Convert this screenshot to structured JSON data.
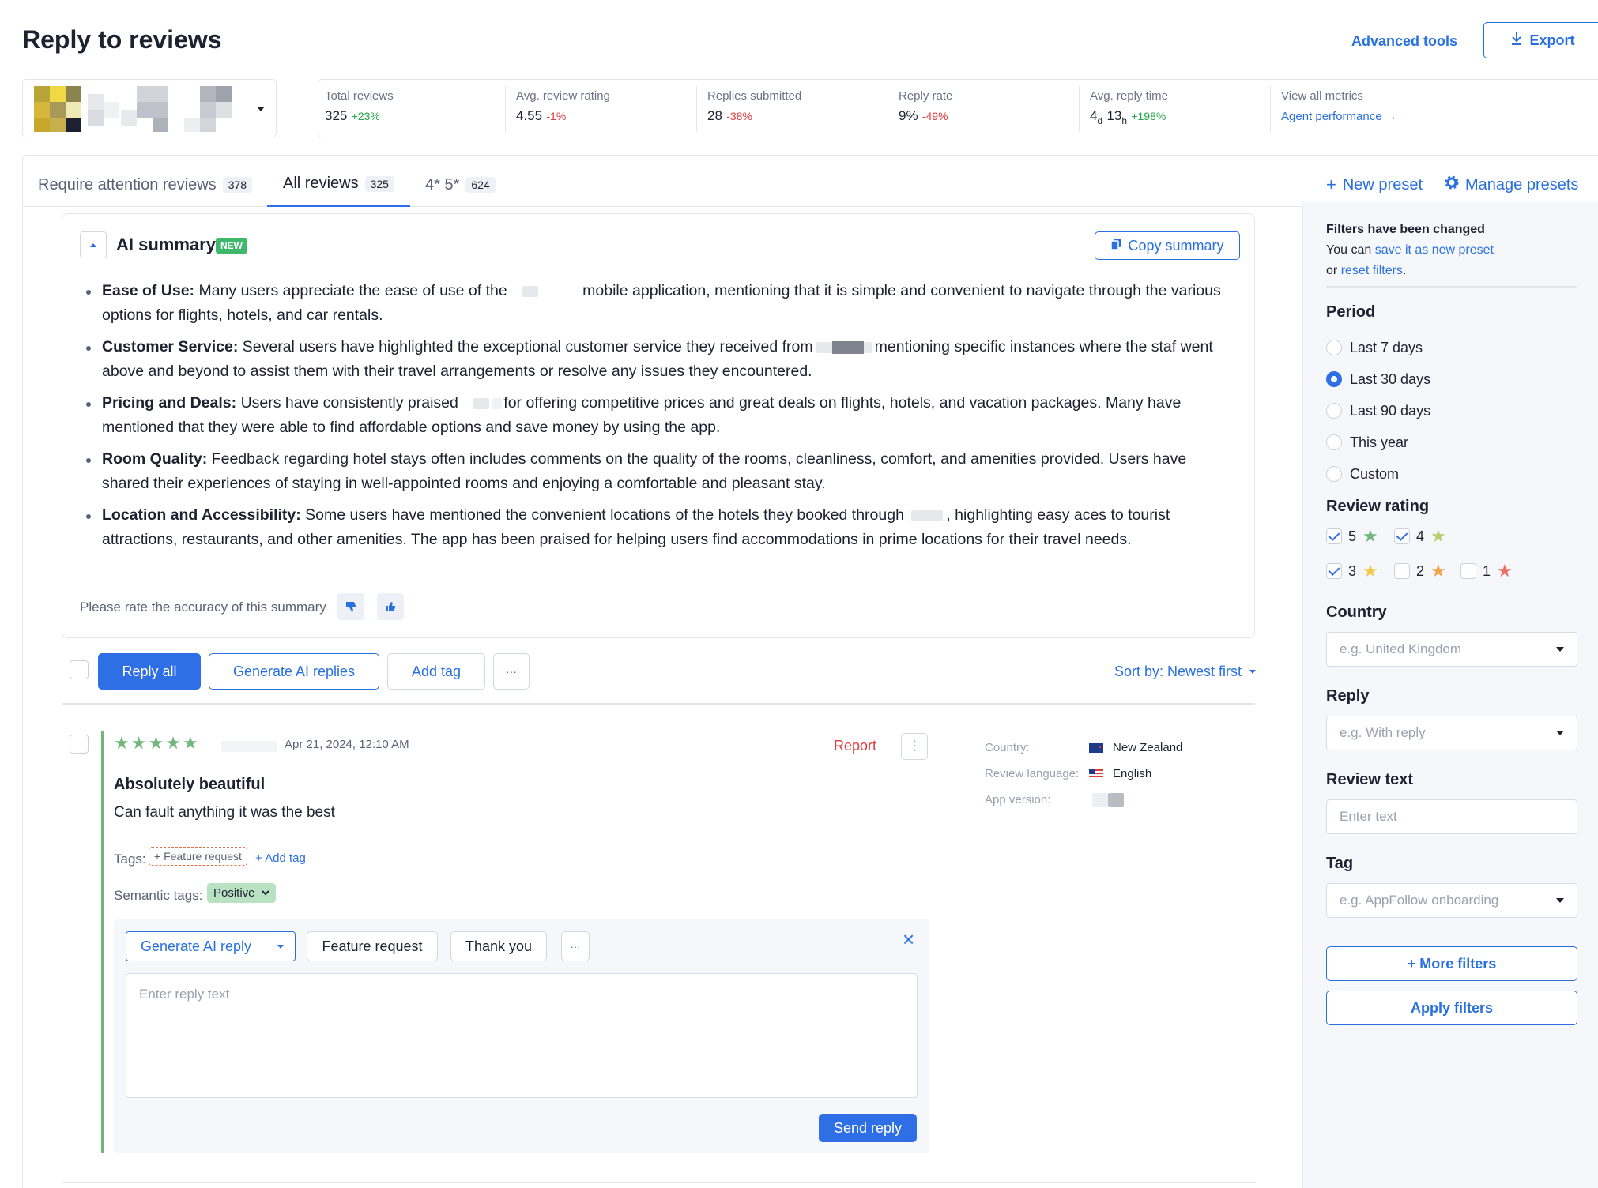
{
  "header": {
    "title": "Reply to reviews",
    "advanced_tools": "Advanced tools",
    "export": "Export"
  },
  "metrics": [
    {
      "label": "Total reviews",
      "value": "325",
      "delta": "+23%",
      "trend": "up"
    },
    {
      "label": "Avg. review rating",
      "value": "4.55",
      "delta": "-1%",
      "trend": "down"
    },
    {
      "label": "Replies submitted",
      "value": "28",
      "delta": "-38%",
      "trend": "down"
    },
    {
      "label": "Reply rate",
      "value": "9%",
      "delta": "-49%",
      "trend": "down"
    },
    {
      "label": "Avg. reply time",
      "value_days": "4",
      "unit_days": "d",
      "value_hours": "13",
      "unit_hours": "h",
      "delta": "+198%",
      "trend": "up"
    }
  ],
  "view_all": {
    "label": "View all metrics",
    "link": "Agent performance →"
  },
  "tabs": [
    {
      "label": "Require attention reviews",
      "count": "378"
    },
    {
      "label": "All reviews",
      "count": "325",
      "active": true
    },
    {
      "label": "4* 5*",
      "count": "624"
    }
  ],
  "presets": {
    "new": "New preset",
    "manage": "Manage presets"
  },
  "ai_summary": {
    "title": "AI summary",
    "badge": "NEW",
    "copy": "Copy summary",
    "items": [
      {
        "head": "Ease of Use:",
        "a": "Many users appreciate the ease of use of the",
        "b": "mobile application, mentioning that it is simple and convenient to navigate through the various options for flights, hotels, and car rentals."
      },
      {
        "head": "Customer Service:",
        "a": "Several users have highlighted the exceptional customer service they received from",
        "b": "mentioning specific instances where the staf went above and beyond to assist them with their travel arrangements or resolve any issues they encountered."
      },
      {
        "head": "Pricing and Deals:",
        "a": "Users have consistently praised",
        "b": "for offering competitive prices and great deals on flights, hotels, and vacation packages. Many have mentioned that they were able to find affordable options and save money by using the app."
      },
      {
        "head": "Room Quality:",
        "a": "Feedback regarding hotel stays often includes comments on the quality of the rooms, cleanliness, comfort, and amenities provided. Users have shared their experiences of staying in well-appointed rooms and enjoying a comfortable and pleasant stay.",
        "b": ""
      },
      {
        "head": "Location and Accessibility:",
        "a": "Some users have mentioned the convenient locations of the hotels they booked through",
        "b": ", highlighting easy aces to tourist attractions, restaurants, and other amenities. The app has been praised for helping users find accommodations in prime locations for their travel needs."
      }
    ],
    "rate_prompt": "Please rate the accuracy of this summary"
  },
  "bulk": {
    "reply_all": "Reply all",
    "generate": "Generate AI replies",
    "add_tag": "Add tag",
    "more": "···",
    "sort": "Sort by: Newest first"
  },
  "review": {
    "rating": 5,
    "date": "Apr 21, 2024, 12:10 AM",
    "report": "Report",
    "title": "Absolutely beautiful",
    "body": "Can fault anything it was the best",
    "tags_label": "Tags:",
    "tag": "+ Feature request",
    "add_tag": "+ Add tag",
    "semantic_label": "Semantic tags:",
    "semantic_tag": "Positive",
    "meta": {
      "country_label": "Country:",
      "country": "New Zealand",
      "language_label": "Review language:",
      "language": "English",
      "version_label": "App version:"
    },
    "reply": {
      "generate": "Generate AI reply",
      "template1": "Feature request",
      "template2": "Thank you",
      "more": "···",
      "placeholder": "Enter reply text",
      "send": "Send reply"
    }
  },
  "filters": {
    "changed_title": "Filters have been changed",
    "changed_text1": "You can",
    "save_link": "save it as new preset",
    "changed_text2": "or",
    "reset_link": "reset filters",
    "period_title": "Period",
    "period_options": [
      "Last 7 days",
      "Last 30 days",
      "Last 90 days",
      "This year",
      "Custom"
    ],
    "period_selected": 1,
    "rating_title": "Review rating",
    "ratings": [
      {
        "value": "5",
        "checked": true,
        "color": "#6fb77a"
      },
      {
        "value": "4",
        "checked": true,
        "color": "#b5cf6b"
      },
      {
        "value": "3",
        "checked": true,
        "color": "#f2c94c"
      },
      {
        "value": "2",
        "checked": false,
        "color": "#f2a24a"
      },
      {
        "value": "1",
        "checked": false,
        "color": "#ef6b5b"
      }
    ],
    "country_title": "Country",
    "country_placeholder": "e.g. United Kingdom",
    "reply_title": "Reply",
    "reply_placeholder": "e.g. With reply",
    "text_title": "Review text",
    "text_placeholder": "Enter text",
    "tag_title": "Tag",
    "tag_placeholder": "e.g. AppFollow onboarding",
    "more_filters": "+ More filters",
    "apply": "Apply filters"
  }
}
